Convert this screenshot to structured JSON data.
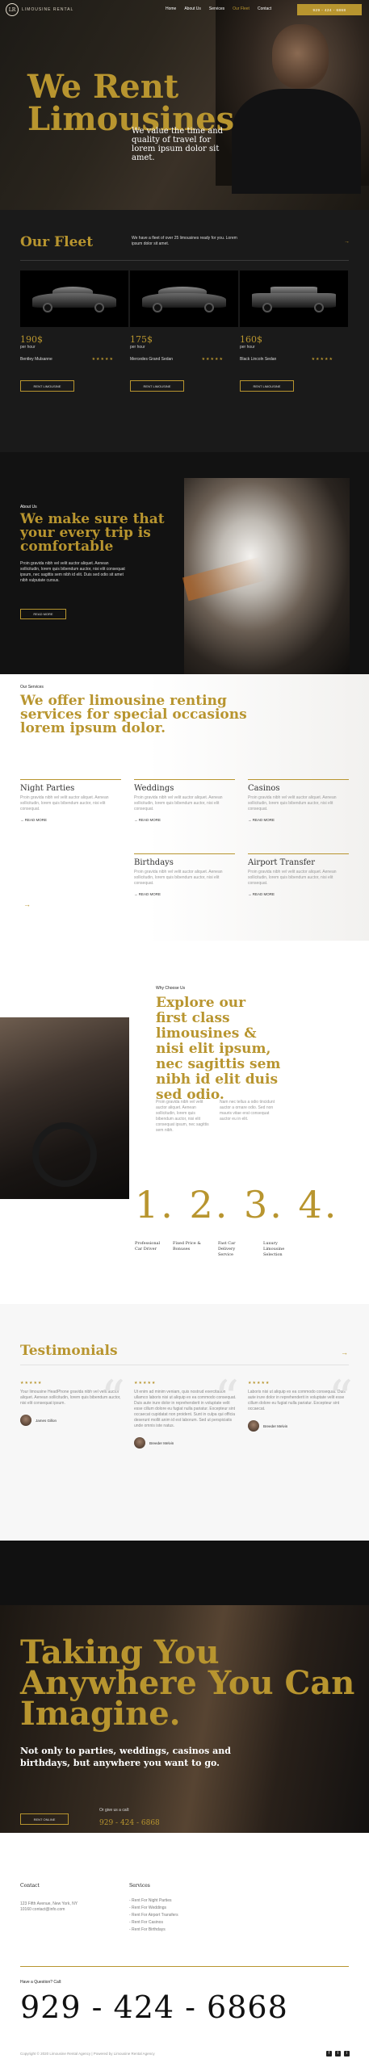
{
  "header": {
    "logo_mark": "LR",
    "logo_text": "LIMOUSINE RENTAL",
    "nav": [
      "Home",
      "About Us",
      "Services",
      "Our Fleet",
      "Contact"
    ],
    "cta": "929 - 424 - 6868"
  },
  "hero": {
    "title": "We Rent Limousines",
    "subtitle": "We value the time and quality of travel for lorem ipsum dolor sit amet."
  },
  "fleet": {
    "title": "Our Fleet",
    "description": "We have a fleet of over 25 limousines ready for you. Lorem ipsum dolor sit amet.",
    "arrow": "→",
    "cars": [
      {
        "price": "190$",
        "per": "per hour",
        "name": "Bentley Mulsanne",
        "stars": "★★★★★",
        "button": "RENT LIMOUSINE"
      },
      {
        "price": "175$",
        "per": "per hour",
        "name": "Mercedes Grand Sedan",
        "stars": "★★★★★",
        "button": "RENT LIMOUSINE"
      },
      {
        "price": "160$",
        "per": "per hour",
        "name": "Black Lincoln Sedan",
        "stars": "★★★★★",
        "button": "RENT LIMOUSINE"
      }
    ]
  },
  "about": {
    "small": "About Us",
    "title": "We make sure that your every trip is comfortable",
    "text": "Proin gravida nibh vel velit auctor aliquet. Aenean sollicitudin, lorem quis bibendum auctor, nisi elit consequat ipsum, nec sagittis sem nibh id elit. Duis sed odio sit amet nibh vulputate cursus.",
    "button": "READ MORE"
  },
  "services": {
    "small": "Our Services",
    "title": "We offer limousine renting services for special occasions lorem ipsum dolor.",
    "items": [
      {
        "title": "Night Parties",
        "text": "Proin gravida nibh vel velit auctor aliquet. Aenean sollicitudin, lorem quis bibendum auctor, nisi elit consequat.",
        "more": "→ READ MORE"
      },
      {
        "title": "Weddings",
        "text": "Proin gravida nibh vel velit auctor aliquet. Aenean sollicitudin, lorem quis bibendum auctor, nisi elit consequat.",
        "more": "→ READ MORE"
      },
      {
        "title": "Casinos",
        "text": "Proin gravida nibh vel velit auctor aliquet. Aenean sollicitudin, lorem quis bibendum auctor, nisi elit consequat.",
        "more": "→ READ MORE"
      },
      {
        "title": "Birthdays",
        "text": "Proin gravida nibh vel velit auctor aliquet. Aenean sollicitudin, lorem quis bibendum auctor, nisi elit consequat.",
        "more": "→ READ MORE"
      },
      {
        "title": "Airport Transfer",
        "text": "Proin gravida nibh vel velit auctor aliquet. Aenean sollicitudin, lorem quis bibendum auctor, nisi elit consequat.",
        "more": "→ READ MORE"
      }
    ],
    "arrow": "→"
  },
  "why": {
    "small": "Why Choose Us",
    "title": "Explore our first class limousines & nisi elit ipsum, nec sagittis sem nibh id elit duis sed odio.",
    "p1": "Proin gravida nibh vel velit auctor aliquet. Aenean sollicitudin, lorem quis bibendum auctor, nisi elit consequat ipsum, nec sagittis sem nibh.",
    "p2": "Nam nec tellus a odio tincidunt auctor a ornare odio. Sed non mauris vitae erat consequat auctor eu in elit.",
    "numbers": "1. 2. 3. 4.",
    "features": [
      "Professional Car Driver",
      "Fixed Price & Bonuses",
      "Fast Car Delivery Service",
      "Luxury Limousine Selection"
    ]
  },
  "testimonials": {
    "title": "Testimonials",
    "arrow": "→",
    "items": [
      {
        "stars": "★★★★★",
        "text": "Your limousine HeadPhone gravida nibh vel velit auctor aliquet. Aenean sollicitudin, lorem quis bibendum auctor, nisi elit consequat ipsum.",
        "name": "James Gillon"
      },
      {
        "stars": "★★★★★",
        "text": "Ut enim ad minim veniam, quis nostrud exercitation ullamco laboris nisi ut aliquip ex ea commodo consequat. Duis aute irure dolor in reprehenderit in voluptate velit esse cillum dolore eu fugiat nulla pariatur. Excepteur sint occaecat cupidatat non proident. Sunt in culpa qui officia deserunt mollit anim id est laborum. Sed ut perspiciatis unde omnis iste natus.",
        "name": "Breeder Melvin"
      },
      {
        "stars": "★★★★★",
        "text": "Laboris nisi ut aliquip ex ea commodo consequat. Duis aute irure dolor in reprehenderit in voluptate velit esse cillum dolore eu fugiat nulla pariatur. Excepteur sint occaecat.",
        "name": "Breeder Melvin"
      }
    ],
    "quote_mark": "“"
  },
  "cta": {
    "title": "Taking You Anywhere You Can Imagine.",
    "subtitle": "Not only to parties, weddings, casinos and birthdays, but anywhere you want to go.",
    "button": "RENT ONLINE",
    "call_label": "Or give us a call:",
    "call_number": "929 - 424 - 6868"
  },
  "footer": {
    "contact_heading": "Contact",
    "address": "123 Fifth Avenue, New York, NY 10160 contact@info.com",
    "services_heading": "Services",
    "services": [
      "- Rent For Night Parties",
      "- Rent For Weddings",
      "- Rent For Airport Transfers",
      "- Rent For Casinos",
      "- Rent For Birthdays"
    ],
    "question": "Have a Question? Call:",
    "phone": "929 - 424 - 6868",
    "copyright": "Copyright © 2020 Limousine Rental Agency | Powered by Limousine Rental Agency",
    "social": [
      "f",
      "t",
      "i"
    ]
  },
  "colors": {
    "accent": "#b8952f",
    "dark": "#1a1a1a"
  }
}
